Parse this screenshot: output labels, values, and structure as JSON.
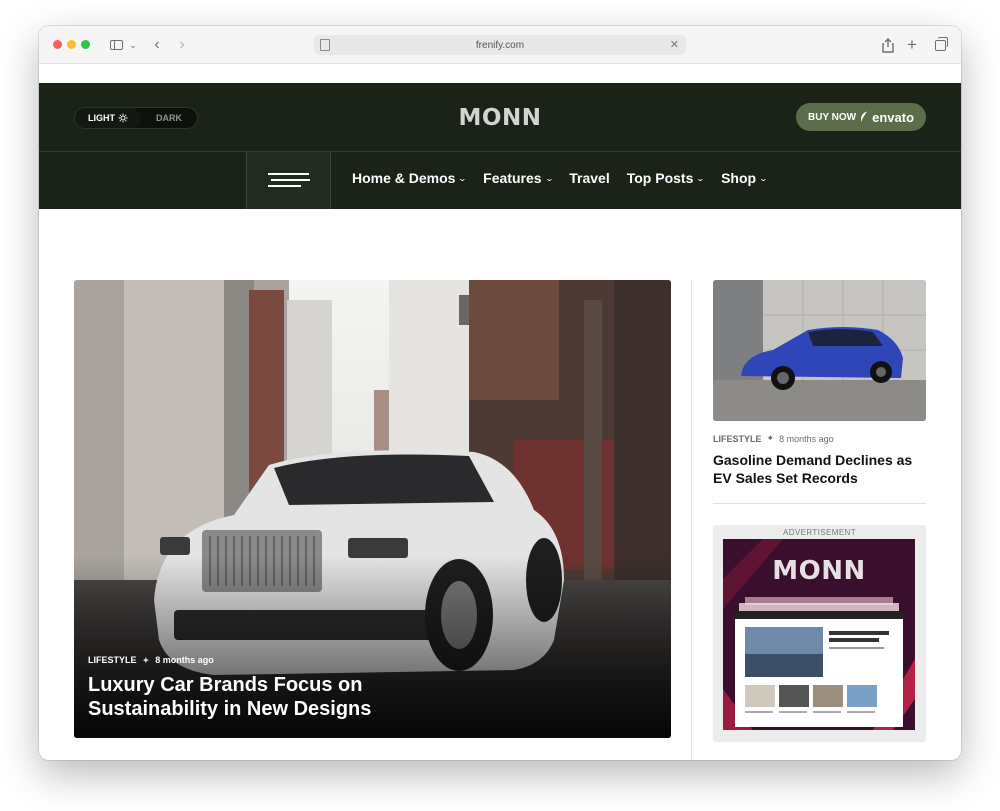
{
  "browser": {
    "url": "frenify.com"
  },
  "header": {
    "theme_toggle": {
      "light": "LIGHT",
      "dark": "DARK"
    },
    "logo": "MONN",
    "buy_button": {
      "label": "BUY NOW",
      "brand": "envato"
    },
    "nav": [
      {
        "label": "Home & Demos",
        "has_dropdown": true
      },
      {
        "label": "Features",
        "has_dropdown": true
      },
      {
        "label": "Travel",
        "has_dropdown": false
      },
      {
        "label": "Top Posts",
        "has_dropdown": true
      },
      {
        "label": "Shop",
        "has_dropdown": true
      }
    ]
  },
  "hero": {
    "category": "LIFESTYLE",
    "time_ago": "8 months ago",
    "title": "Luxury Car Brands Focus on Sustainability in New Designs"
  },
  "side_post": {
    "category": "LIFESTYLE",
    "time_ago": "8 months ago",
    "title": "Gasoline Demand Declines as EV Sales Set Records"
  },
  "advertisement": {
    "label": "ADVERTISEMENT",
    "logo": "MONN"
  },
  "colors": {
    "header_bg": "#1b2319",
    "buy_button_bg": "#5b6d4a",
    "ad_bg": "#3a0f2d"
  },
  "icons": {
    "toggle_light_icon": "sun-icon",
    "menu_icon": "hamburger-icon",
    "dropdown_icon": "chevron-down-icon"
  }
}
